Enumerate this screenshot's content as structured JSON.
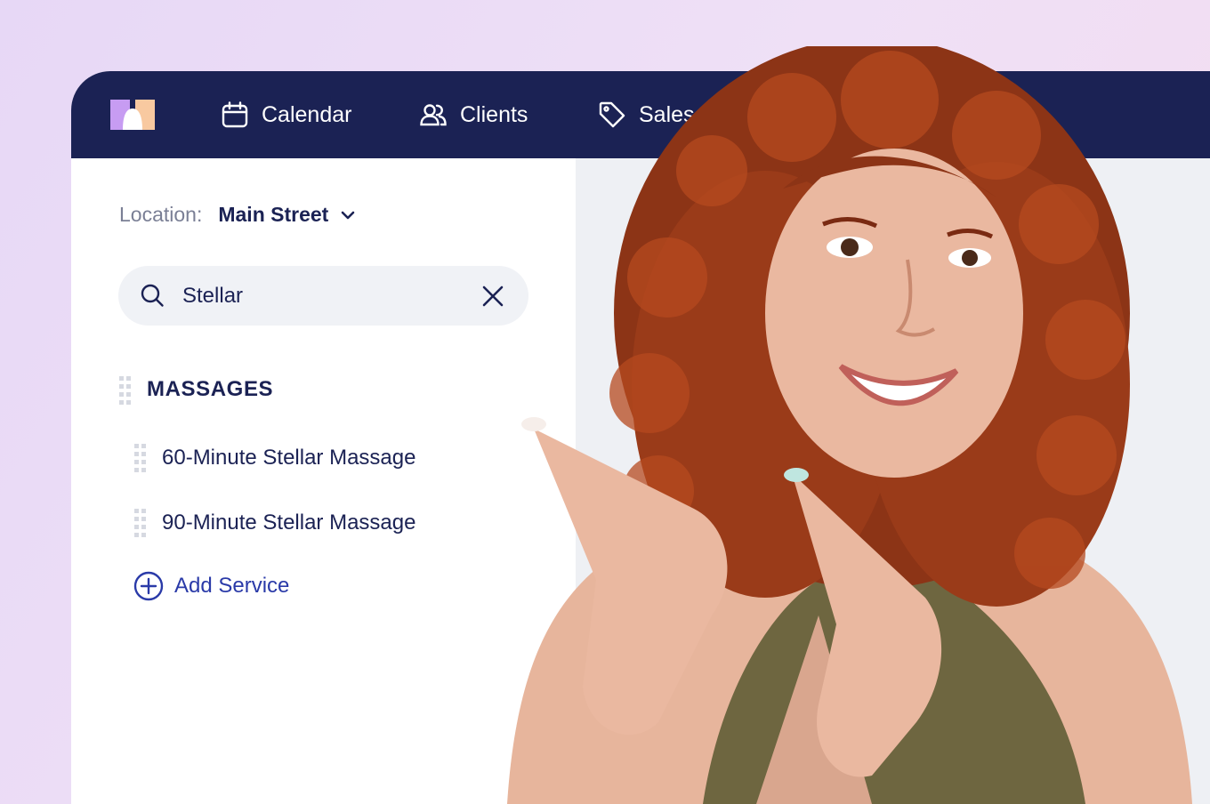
{
  "nav": {
    "logo_icon": "brand-logo-icon",
    "items": [
      {
        "label": "Calendar",
        "icon": "calendar-icon"
      },
      {
        "label": "Clients",
        "icon": "clients-icon"
      },
      {
        "label": "Sales",
        "icon": "tag-icon"
      }
    ]
  },
  "location": {
    "label": "Location:",
    "value": "Main Street"
  },
  "search": {
    "value": "Stellar",
    "placeholder": ""
  },
  "category": {
    "title": "MASSAGES",
    "services": [
      "60-Minute Stellar Massage",
      "90-Minute Stellar Massage"
    ]
  },
  "add_service_label": "Add Service",
  "colors": {
    "nav_bg": "#1b2254",
    "accent": "#2a3aa8",
    "text": "#1b2254",
    "muted": "#7a7f95",
    "logo_purple": "#c79cf2",
    "logo_orange": "#f8c9a0"
  }
}
